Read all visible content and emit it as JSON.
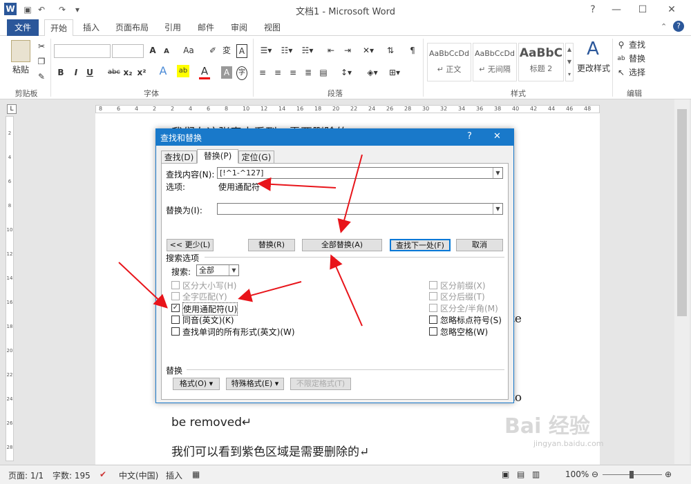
{
  "window": {
    "title": "文档1 - Microsoft Word",
    "help": "?",
    "minimize": "—",
    "restore": "☐",
    "close": "✕"
  },
  "qat": {
    "logo": "W",
    "save": "💾",
    "undo": "↶",
    "redo": "↷"
  },
  "tabs": [
    "文件",
    "开始",
    "插入",
    "页面布局",
    "引用",
    "邮件",
    "审阅",
    "视图"
  ],
  "ribbon": {
    "clipboard": {
      "paste": "粘贴",
      "label": "剪贴板"
    },
    "font": {
      "label": "字体",
      "bold": "B",
      "italic": "I",
      "underline": "U",
      "strike": "abc",
      "sub": "x₂",
      "sup": "x²",
      "grow": "A",
      "shrink": "A",
      "case": "Aa"
    },
    "paragraph": {
      "label": "段落"
    },
    "styles": {
      "label": "样式",
      "items": [
        {
          "preview": "AaBbCcDd",
          "name": "↵ 正文"
        },
        {
          "preview": "AaBbCcDd",
          "name": "↵ 无间隔"
        },
        {
          "preview": "AaBbC",
          "name": "标题 2"
        }
      ],
      "change": "更改样式"
    },
    "editing": {
      "label": "编辑",
      "find": "查找",
      "replace": "替换",
      "select": "选择"
    }
  },
  "ruler": {
    "ticks": [
      "8",
      "6",
      "4",
      "2",
      "2",
      "4",
      "6",
      "8",
      "10",
      "12",
      "14",
      "16",
      "18",
      "20",
      "22",
      "24",
      "26",
      "28",
      "30",
      "32",
      "34",
      "36",
      "38",
      "40",
      "42",
      "44",
      "46",
      "48"
    ]
  },
  "vruler": {
    "ticks": [
      "2",
      "4",
      "6",
      "8",
      "10",
      "12",
      "14",
      "16",
      "18",
      "20",
      "22",
      "24",
      "26",
      "28"
    ]
  },
  "document": {
    "line_top": "我们在这张表中看到，需要删除的......",
    "line_right1": "te",
    "line_right2": "to",
    "line_removed": "be removed↵",
    "line_last": "我们可以看到紫色区域是需要删除的↵"
  },
  "dialog": {
    "title": "查找和替换",
    "help": "?",
    "close": "✕",
    "tabs": [
      "查找(D)",
      "替换(P)",
      "定位(G)"
    ],
    "find_label": "查找内容(N):",
    "find_value": "[!^1-^127]",
    "options_label": "选项:",
    "options_value": "使用通配符",
    "replace_label": "替换为(I):",
    "replace_value": "",
    "buttons": {
      "less": "<< 更少(L)",
      "replace": "替换(R)",
      "replace_all": "全部替换(A)",
      "find_next": "查找下一处(F)",
      "cancel": "取消"
    },
    "search_options": "搜索选项",
    "search_label": "搜索:",
    "search_value": "全部",
    "left_checks": [
      {
        "label": "区分大小写(H)",
        "checked": false,
        "disabled": true
      },
      {
        "label": "全字匹配(Y)",
        "checked": false,
        "disabled": true
      },
      {
        "label": "使用通配符(U)",
        "checked": true,
        "disabled": false
      },
      {
        "label": "同音(英文)(K)",
        "checked": false,
        "disabled": false
      },
      {
        "label": "查找单词的所有形式(英文)(W)",
        "checked": false,
        "disabled": false
      }
    ],
    "right_checks": [
      {
        "label": "区分前缀(X)",
        "checked": false,
        "disabled": true
      },
      {
        "label": "区分后缀(T)",
        "checked": false,
        "disabled": true
      },
      {
        "label": "区分全/半角(M)",
        "checked": false,
        "disabled": true
      },
      {
        "label": "忽略标点符号(S)",
        "checked": false,
        "disabled": false
      },
      {
        "label": "忽略空格(W)",
        "checked": false,
        "disabled": false
      }
    ],
    "replace_section": "替换",
    "format_btn": "格式(O) ▾",
    "special_btn": "特殊格式(E) ▾",
    "noformat_btn": "不限定格式(T)"
  },
  "status": {
    "page": "页面: 1/1",
    "words": "字数: 195",
    "lang": "中文(中国)",
    "insert": "插入",
    "zoom": "100%"
  },
  "watermark": {
    "brand": "Bai 经验",
    "url": "jingyan.baidu.com"
  },
  "colors": {
    "accent": "#2b579a",
    "dialog_blue": "#1979ca",
    "arrow": "#e8141a"
  }
}
